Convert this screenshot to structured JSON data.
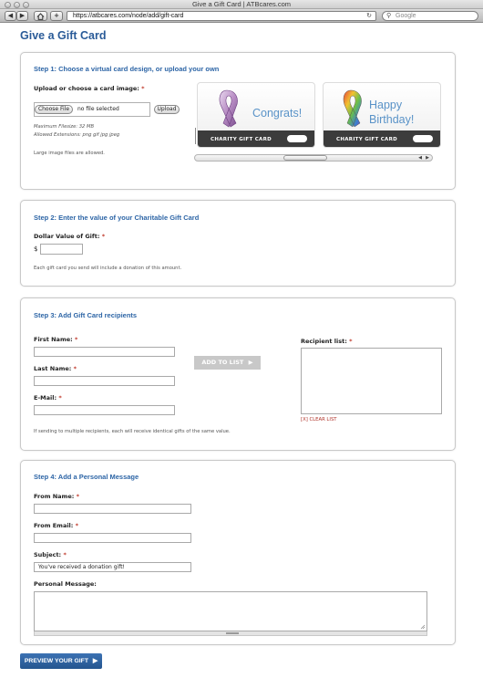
{
  "window": {
    "title": "Give a Gift Card | ATBcares.com"
  },
  "toolbar": {
    "back_icon": "back-arrow-icon",
    "forward_icon": "forward-arrow-icon",
    "home_icon": "home-icon",
    "add_icon": "plus-icon",
    "url": "https://atbcares.com/node/add/gift-card",
    "reload_icon": "reload-icon",
    "search_placeholder": "Google"
  },
  "page": {
    "title": "Give a Gift Card"
  },
  "step1": {
    "title": "Step 1: Choose a virtual card design, or upload your own",
    "upload_label": "Upload or choose a card image:",
    "required_mark": "*",
    "choose_file_label": "Choose File",
    "no_file_text": "no file selected",
    "upload_button": "Upload",
    "max_filesize": "Maximum Filesize: 32 MB",
    "allowed_ext": "Allowed Extensions: png gif jpg jpeg",
    "large_note": "Large image files are allowed.",
    "cards": [
      {
        "greeting": "Congrats!",
        "band_label": "CHARITY GIFT CARD"
      },
      {
        "greeting_line1": "Happy",
        "greeting_line2": "Birthday!",
        "band_label": "CHARITY GIFT CARD"
      }
    ]
  },
  "step2": {
    "title": "Step 2: Enter the value of your Charitable Gift Card",
    "value_label": "Dollar Value of Gift:",
    "required_mark": "*",
    "currency_symbol": "$",
    "note": "Each gift card you send will include a donation of this amount."
  },
  "step3": {
    "title": "Step 3: Add Gift Card recipients",
    "first_name_label": "First Name:",
    "last_name_label": "Last Name:",
    "email_label": "E-Mail:",
    "required_mark": "*",
    "add_button": "ADD TO LIST",
    "recipient_list_label": "Recipient list:",
    "clear_list": "[X] CLEAR LIST",
    "note": "If sending to multiple recipients, each will receive identical gifts of the same value."
  },
  "step4": {
    "title": "Step 4: Add a Personal Message",
    "from_name_label": "From Name:",
    "from_email_label": "From Email:",
    "subject_label": "Subject:",
    "required_mark": "*",
    "subject_value": "You've received a donation gift!",
    "message_label": "Personal Message:"
  },
  "actions": {
    "preview_button": "PREVIEW YOUR GIFT"
  },
  "colors": {
    "heading_blue": "#2a5b98",
    "step_blue": "#2d65a6",
    "required_red": "#c0392b",
    "button_blue": "#2c5f9e"
  }
}
